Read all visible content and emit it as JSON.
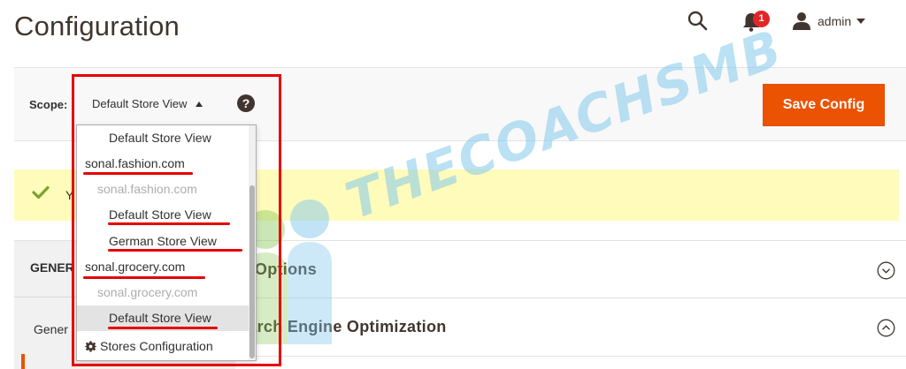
{
  "page": {
    "title": "Configuration"
  },
  "header": {
    "notification_count": "1",
    "user_name": "admin"
  },
  "scope": {
    "label": "Scope:",
    "current": "Default Store View",
    "save_label": "Save Config"
  },
  "message": {
    "text": "Y"
  },
  "tabs": {
    "general_label": "GENER",
    "general_item_label": "Gener"
  },
  "sections": [
    {
      "title": "rl Options"
    },
    {
      "title": "earch Engine Optimization"
    }
  ],
  "dropdown": {
    "items": [
      {
        "type": "view",
        "label": "Default Store View"
      },
      {
        "type": "website",
        "label": "sonal.fashion.com"
      },
      {
        "type": "store",
        "label": "sonal.fashion.com"
      },
      {
        "type": "view",
        "label": "Default Store View"
      },
      {
        "type": "view",
        "label": "German Store View"
      },
      {
        "type": "website",
        "label": "sonal.grocery.com"
      },
      {
        "type": "store",
        "label": "sonal.grocery.com"
      },
      {
        "type": "view",
        "label": "Default Store View"
      }
    ],
    "footer_label": "Stores Configuration"
  },
  "watermark": {
    "text": "THECOACHSMB"
  },
  "colors": {
    "accent": "#eb5202",
    "annotation": "#e60000",
    "message_bg": "#fffbbb"
  },
  "icons": {
    "search": "search-icon",
    "bell": "bell-icon",
    "user": "user-icon",
    "help": "help-icon",
    "check": "check-icon",
    "chevron": "chevron-circle-icon",
    "gear": "gear-icon"
  }
}
